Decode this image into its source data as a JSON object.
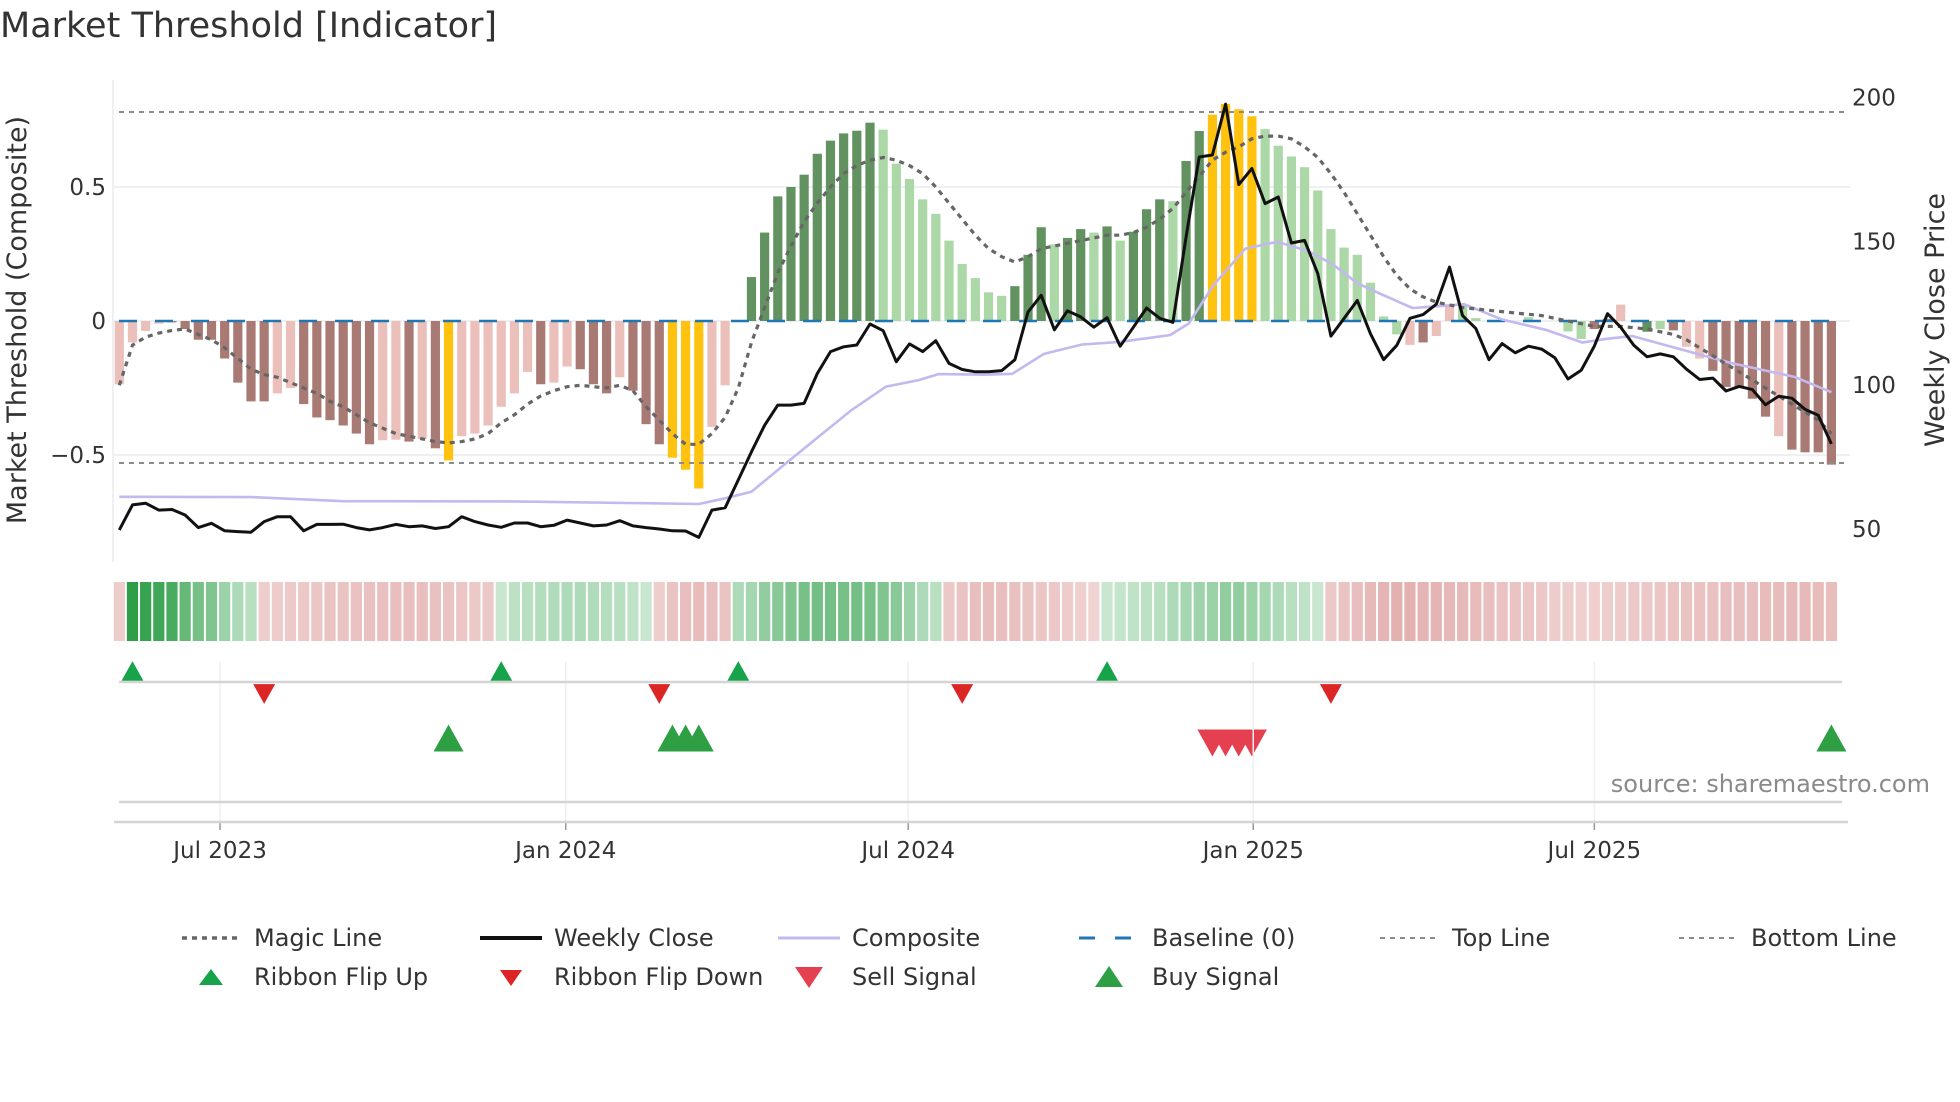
{
  "title": "Market Threshold [Indicator]",
  "source": "source: sharemaestro.com",
  "chart_data": {
    "type": "bar",
    "title": "Market Threshold [Indicator]",
    "x_unit": "week index (weekly bars)",
    "left_axis": {
      "label": "Market Threshold (Composite)",
      "ticks": [
        0.5,
        0,
        -0.5
      ],
      "tick_labels": [
        "0.5",
        "0",
        "−0.5"
      ],
      "range": [
        -0.85,
        0.9
      ]
    },
    "right_axis": {
      "label": "Weekly Close Price",
      "ticks": [
        200,
        150,
        100,
        50
      ],
      "tick_labels": [
        "200",
        "150",
        "100",
        "50"
      ]
    },
    "x_ticks": [
      {
        "label": "Jul 2023",
        "week": 7.65
      },
      {
        "label": "Jan 2024",
        "week": 33.9
      },
      {
        "label": "Jul 2024",
        "week": 59.9
      },
      {
        "label": "Jan 2025",
        "week": 86.1
      },
      {
        "label": "Jul 2025",
        "week": 112.0
      }
    ],
    "top_line": 0.78,
    "bottom_line": -0.53,
    "baseline": 0,
    "composite_bars": [
      -0.236,
      -0.08,
      -0.037,
      -0.01,
      -0.005,
      -0.03,
      -0.07,
      -0.07,
      -0.14,
      -0.23,
      -0.3,
      -0.3,
      -0.27,
      -0.25,
      -0.31,
      -0.36,
      -0.37,
      -0.39,
      -0.42,
      -0.46,
      -0.445,
      -0.443,
      -0.45,
      -0.44,
      -0.475,
      -0.52,
      -0.43,
      -0.42,
      -0.39,
      -0.32,
      -0.27,
      -0.19,
      -0.236,
      -0.23,
      -0.17,
      -0.18,
      -0.236,
      -0.27,
      -0.21,
      -0.26,
      -0.385,
      -0.46,
      -0.51,
      -0.555,
      -0.625,
      -0.395,
      -0.24,
      0,
      0.164,
      0.33,
      0.465,
      0.5,
      0.546,
      0.624,
      0.673,
      0.7,
      0.71,
      0.74,
      0.714,
      0.587,
      0.53,
      0.454,
      0.4,
      0.3,
      0.213,
      0.16,
      0.107,
      0.094,
      0.13,
      0.247,
      0.35,
      0.286,
      0.31,
      0.343,
      0.33,
      0.353,
      0.3,
      0.333,
      0.417,
      0.454,
      0.447,
      0.597,
      0.709,
      0.77,
      0.81,
      0.79,
      0.764,
      0.716,
      0.654,
      0.614,
      0.574,
      0.487,
      0.343,
      0.274,
      0.247,
      0.143,
      0.017,
      -0.05,
      -0.089,
      -0.08,
      -0.056,
      0.061,
      0.059,
      0.011,
      0,
      0,
      0,
      0.014,
      0,
      0,
      -0.039,
      -0.067,
      -0.03,
      0.008,
      0.061,
      0,
      -0.04,
      -0.03,
      -0.035,
      -0.096,
      -0.14,
      -0.186,
      -0.246,
      -0.246,
      -0.29,
      -0.357,
      -0.43,
      -0.48,
      -0.49,
      -0.49,
      -0.536
    ],
    "bar_states": "LLLLDDDDDDDDLLDDDDDDLLDLDYLLLLLLDLLDDDLDDDYYYLLLGGGGGGGGGGggggggggggGGGgGGgGgGGGgGGYYYYgggggggggggLDLLgggggggGggDDLgGgDLLDDDDDLDDDDLY",
    "bar_state_colors": {
      "D": "#a97a74",
      "L": "#ebbfba",
      "G": "#62925f",
      "g": "#acd7a7",
      "Y": "#ffc20e"
    },
    "magic_line": [
      -0.24,
      -0.09,
      -0.06,
      -0.045,
      -0.035,
      -0.03,
      -0.05,
      -0.07,
      -0.1,
      -0.14,
      -0.18,
      -0.2,
      -0.21,
      -0.23,
      -0.25,
      -0.27,
      -0.3,
      -0.32,
      -0.35,
      -0.38,
      -0.4,
      -0.42,
      -0.43,
      -0.44,
      -0.45,
      -0.455,
      -0.45,
      -0.44,
      -0.42,
      -0.38,
      -0.35,
      -0.31,
      -0.28,
      -0.26,
      -0.245,
      -0.24,
      -0.245,
      -0.25,
      -0.24,
      -0.26,
      -0.32,
      -0.37,
      -0.42,
      -0.46,
      -0.46,
      -0.42,
      -0.36,
      -0.25,
      -0.08,
      0.05,
      0.18,
      0.28,
      0.37,
      0.44,
      0.5,
      0.55,
      0.58,
      0.6,
      0.61,
      0.6,
      0.58,
      0.55,
      0.5,
      0.44,
      0.38,
      0.32,
      0.27,
      0.24,
      0.22,
      0.24,
      0.27,
      0.28,
      0.29,
      0.3,
      0.31,
      0.32,
      0.32,
      0.33,
      0.35,
      0.38,
      0.42,
      0.48,
      0.54,
      0.6,
      0.63,
      0.65,
      0.68,
      0.69,
      0.69,
      0.68,
      0.65,
      0.61,
      0.55,
      0.48,
      0.4,
      0.32,
      0.24,
      0.17,
      0.12,
      0.09,
      0.07,
      0.06,
      0.05,
      0.045,
      0.04,
      0.035,
      0.03,
      0.025,
      0.02,
      0.01,
      0,
      -0.01,
      -0.02,
      -0.02,
      -0.02,
      -0.025,
      -0.03,
      -0.04,
      -0.05,
      -0.07,
      -0.1,
      -0.13,
      -0.16,
      -0.19,
      -0.22,
      -0.25,
      -0.28,
      -0.31,
      -0.34,
      -0.37,
      -0.42
    ],
    "weekly_close": [
      49.6,
      58.3,
      58.9,
      56.5,
      56.7,
      54.8,
      50.4,
      51.9,
      49.3,
      49.0,
      48.8,
      52.5,
      54.2,
      54.2,
      49.3,
      51.5,
      51.5,
      51.6,
      50.4,
      49.6,
      50.4,
      51.5,
      50.7,
      51.0,
      50.1,
      50.7,
      54.2,
      52.5,
      51.3,
      50.5,
      52.0,
      52.0,
      50.7,
      51.2,
      53.0,
      52.0,
      51.0,
      51.3,
      52.8,
      51.0,
      50.4,
      49.9,
      49.3,
      49.2,
      47.0,
      56.5,
      57.3,
      67.0,
      76.8,
      86.0,
      93.0,
      93.0,
      93.6,
      104.0,
      111.6,
      113.3,
      113.9,
      121.2,
      118.9,
      108.1,
      114.3,
      111.6,
      115.4,
      107.5,
      105.4,
      104.6,
      104.6,
      105.0,
      108.8,
      125.4,
      131.2,
      119.2,
      125.8,
      123.7,
      120.1,
      123.4,
      113.5,
      120.1,
      126.8,
      123.2,
      121.8,
      151.5,
      179.3,
      180.0,
      197.7,
      169.7,
      175.3,
      163.1,
      165.4,
      149.4,
      150.3,
      138.7,
      117.0,
      123.2,
      129.4,
      117.8,
      108.8,
      113.8,
      123.2,
      124.5,
      128.1,
      141.0,
      124.1,
      119.7,
      108.8,
      114.4,
      111.2,
      113.5,
      112.5,
      109.5,
      102.1,
      105.1,
      113.5,
      124.8,
      120.1,
      113.8,
      109.8,
      110.8,
      109.8,
      105.5,
      101.9,
      102.4,
      97.9,
      99.5,
      98.4,
      93.1,
      96.1,
      95.4,
      91.5,
      89.5,
      79.5
    ],
    "composite_line_knots": [
      [
        0,
        61.1
      ],
      [
        10,
        61
      ],
      [
        17,
        59.6
      ],
      [
        30,
        59.5
      ],
      [
        44,
        58.6
      ],
      [
        46,
        60.6
      ],
      [
        48,
        62.9
      ],
      [
        50.6,
        72.7
      ],
      [
        53.1,
        82
      ],
      [
        55.6,
        91.3
      ],
      [
        58.2,
        99.4
      ],
      [
        60.7,
        101.7
      ],
      [
        62.2,
        103.8
      ],
      [
        65.8,
        103.6
      ],
      [
        67.8,
        103.9
      ],
      [
        70.2,
        110.8
      ],
      [
        73.1,
        114.1
      ],
      [
        76,
        115
      ],
      [
        79.8,
        117.4
      ],
      [
        81.2,
        121.4
      ],
      [
        83.1,
        134.8
      ],
      [
        85.5,
        147.4
      ],
      [
        87.9,
        149.8
      ],
      [
        90.2,
        146.7
      ],
      [
        92.1,
        142.1
      ],
      [
        94,
        135.4
      ],
      [
        95.9,
        131.4
      ],
      [
        98.2,
        126.8
      ],
      [
        100.2,
        127.4
      ],
      [
        102.1,
        128.1
      ],
      [
        105,
        122.8
      ],
      [
        108.3,
        119.2
      ],
      [
        111.1,
        114.8
      ],
      [
        113,
        116.1
      ],
      [
        114.9,
        117
      ],
      [
        117.7,
        113.5
      ],
      [
        122.5,
        107.5
      ],
      [
        127.2,
        102.8
      ],
      [
        130,
        97.5
      ]
    ],
    "ribbon": [
      -0.2,
      1,
      0.95,
      0.9,
      0.85,
      0.7,
      0.6,
      0.55,
      0.4,
      0.3,
      0.25,
      -0.2,
      -0.22,
      -0.24,
      -0.26,
      -0.28,
      -0.3,
      -0.3,
      -0.32,
      -0.33,
      -0.34,
      -0.35,
      -0.35,
      -0.35,
      -0.33,
      -0.3,
      -0.28,
      -0.26,
      -0.25,
      0.15,
      0.22,
      0.25,
      0.27,
      0.28,
      0.3,
      0.3,
      0.28,
      0.26,
      0.24,
      0.2,
      0.15,
      -0.2,
      -0.3,
      -0.35,
      -0.38,
      -0.35,
      -0.3,
      0.3,
      0.35,
      0.45,
      0.5,
      0.55,
      0.6,
      0.62,
      0.62,
      0.6,
      0.62,
      0.6,
      0.55,
      0.5,
      0.4,
      0.3,
      0.25,
      -0.25,
      -0.3,
      -0.35,
      -0.37,
      -0.35,
      -0.33,
      -0.3,
      -0.28,
      -0.25,
      -0.22,
      -0.18,
      -0.15,
      0.15,
      0.18,
      0.2,
      0.22,
      0.25,
      0.3,
      0.35,
      0.38,
      0.4,
      0.45,
      0.45,
      0.4,
      0.35,
      0.3,
      0.25,
      0.2,
      0.15,
      -0.25,
      -0.3,
      -0.35,
      -0.4,
      -0.45,
      -0.5,
      -0.5,
      -0.45,
      -0.45,
      -0.42,
      -0.4,
      -0.38,
      -0.35,
      -0.32,
      -0.3,
      -0.28,
      -0.25,
      -0.22,
      -0.2,
      -0.18,
      -0.18,
      -0.2,
      -0.22,
      -0.25,
      -0.25,
      -0.28,
      -0.3,
      -0.3,
      -0.32,
      -0.32,
      -0.35,
      -0.35,
      -0.35,
      -0.38,
      -0.38,
      -0.4,
      -0.4,
      -0.38,
      -0.36
    ],
    "ribbon_flip_up": [
      1,
      29,
      47,
      75
    ],
    "ribbon_flip_down": [
      11,
      41,
      64,
      92
    ],
    "buy_signals": [
      25,
      42,
      43,
      44,
      130
    ],
    "sell_signals": [
      83,
      84,
      85,
      86
    ],
    "colors": {
      "magic": "#666666",
      "close": "#111111",
      "composite": "#c3b8ef",
      "baseline": "#1f77b4",
      "guide": "#8c8c8c",
      "flip_up": "#16a34a",
      "flip_down": "#dc2626",
      "buy": "#2ea043",
      "sell": "#e5404f"
    },
    "legend": [
      {
        "key": "magic",
        "label": "Magic Line"
      },
      {
        "key": "close",
        "label": "Weekly Close"
      },
      {
        "key": "composite",
        "label": "Composite"
      },
      {
        "key": "baseline",
        "label": "Baseline (0)"
      },
      {
        "key": "top",
        "label": "Top Line"
      },
      {
        "key": "bottom",
        "label": "Bottom Line"
      },
      {
        "key": "flip_up",
        "label": "Ribbon Flip Up"
      },
      {
        "key": "flip_down",
        "label": "Ribbon Flip Down"
      },
      {
        "key": "sell",
        "label": "Sell Signal"
      },
      {
        "key": "buy",
        "label": "Buy Signal"
      }
    ]
  }
}
